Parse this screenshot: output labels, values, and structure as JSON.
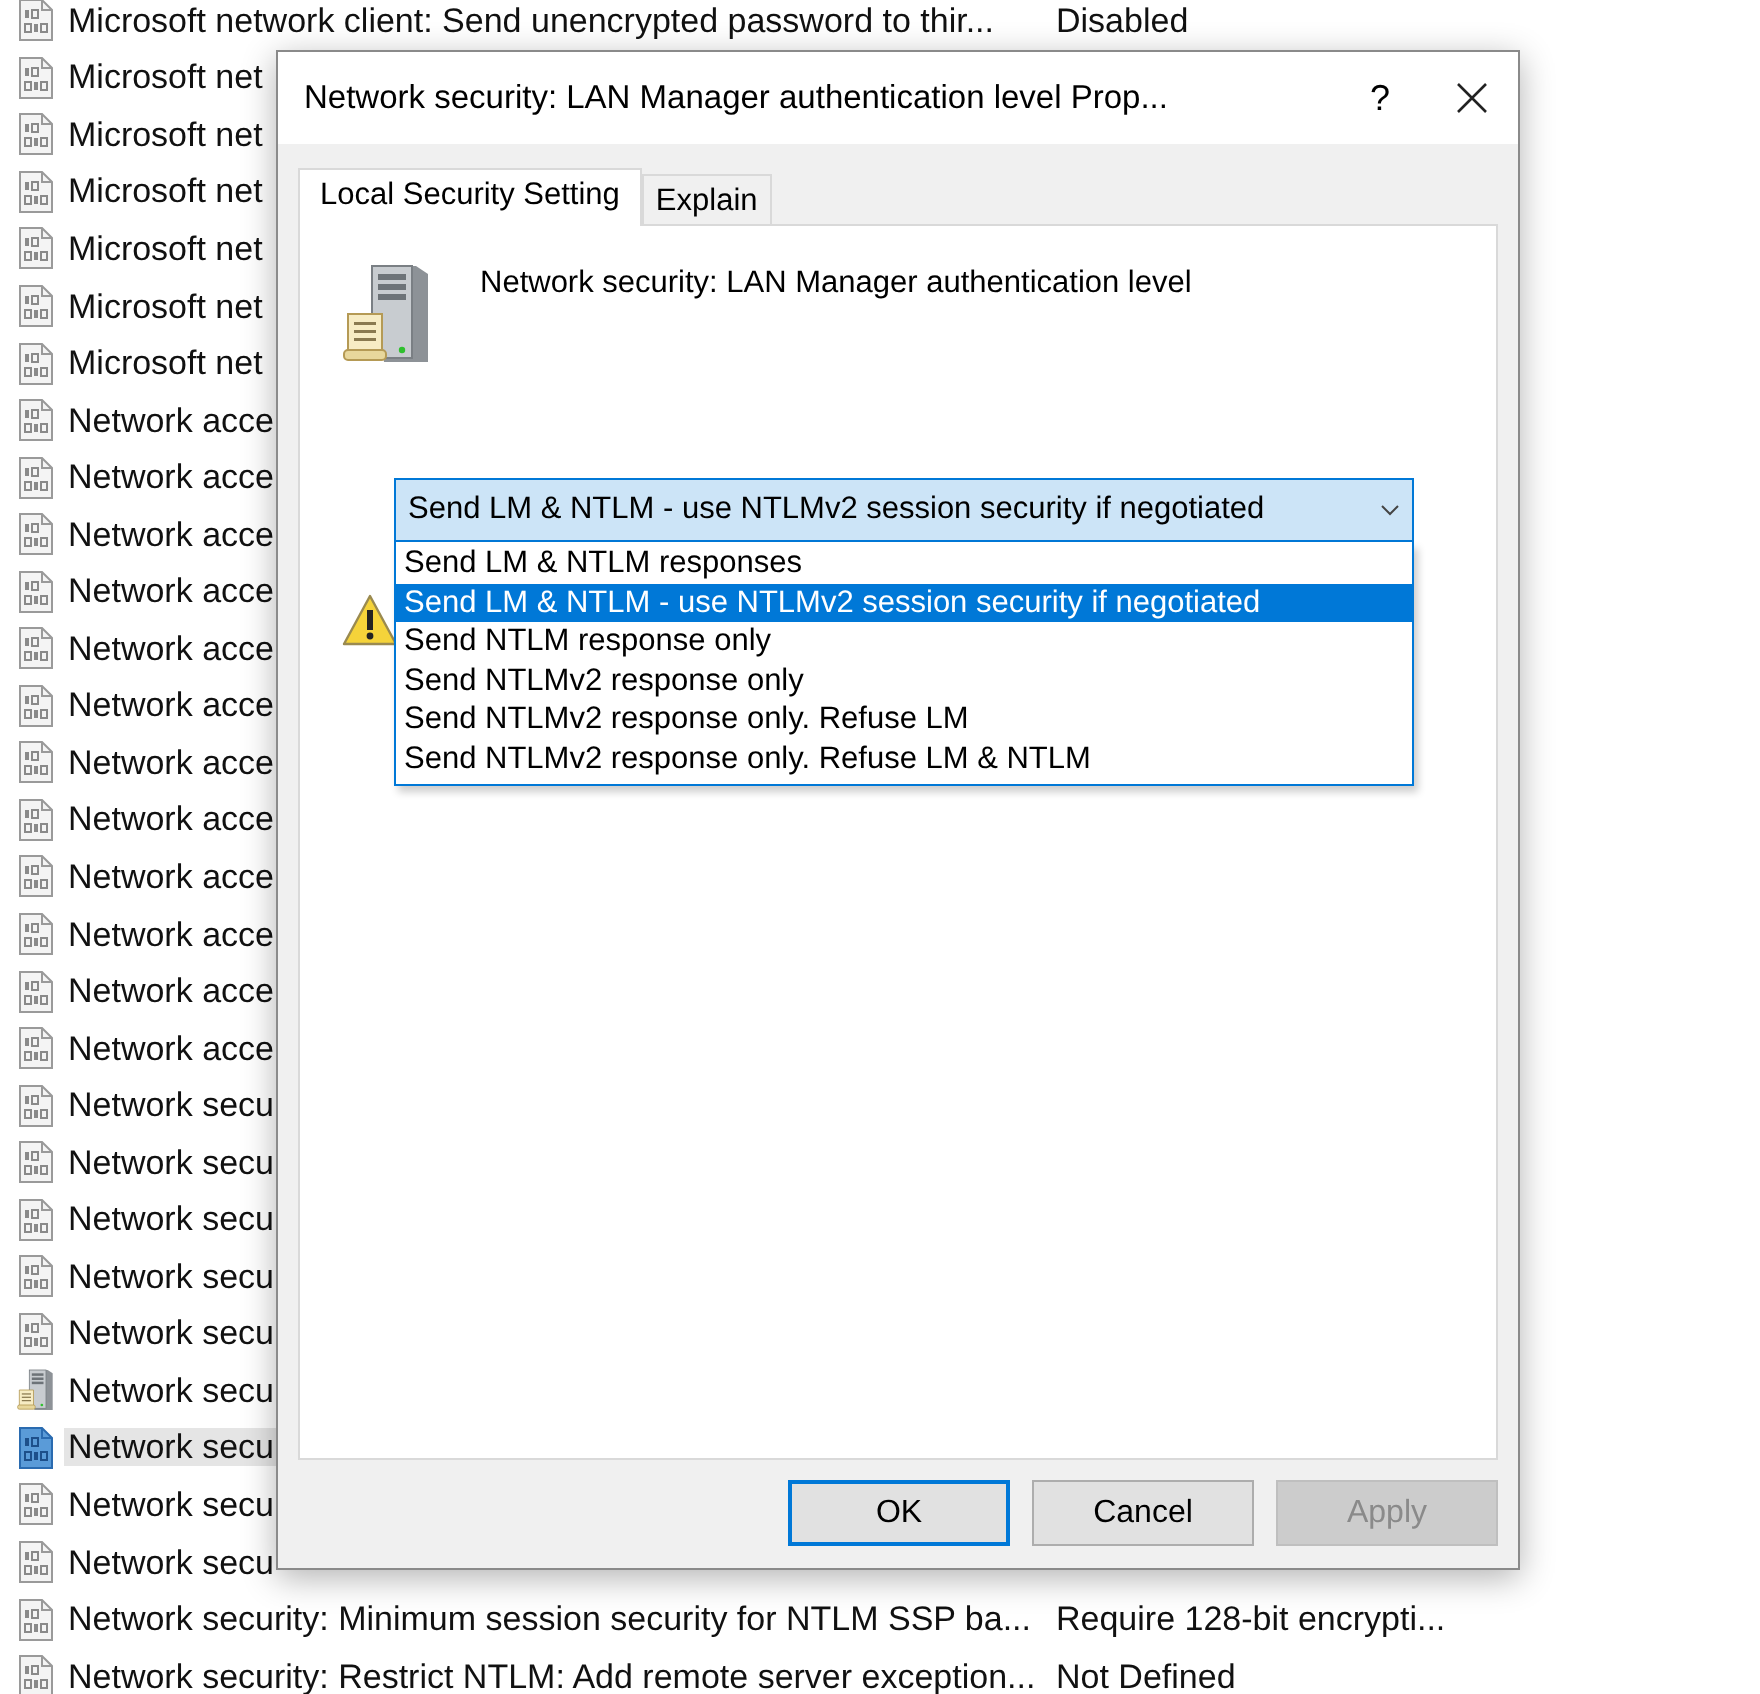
{
  "policy_list": {
    "rows": [
      {
        "name": "Microsoft network client: Send unencrypted password to thir...",
        "setting": "Disabled",
        "kind": "policy",
        "selected": false
      },
      {
        "name": "Microsoft net",
        "kind": "policy",
        "selected": false
      },
      {
        "name": "Microsoft net",
        "kind": "policy",
        "selected": false
      },
      {
        "name": "Microsoft net",
        "kind": "policy",
        "selected": false
      },
      {
        "name": "Microsoft net",
        "kind": "policy",
        "selected": false
      },
      {
        "name": "Microsoft net",
        "kind": "policy",
        "selected": false
      },
      {
        "name": "Microsoft net",
        "kind": "policy",
        "selected": false
      },
      {
        "name": "Network acce",
        "kind": "policy",
        "selected": false
      },
      {
        "name": "Network acce",
        "kind": "policy",
        "selected": false
      },
      {
        "name": "Network acce",
        "kind": "policy",
        "selected": false
      },
      {
        "name": "Network acce",
        "kind": "policy",
        "selected": false
      },
      {
        "name": "Network acce",
        "kind": "policy",
        "selected": false
      },
      {
        "name": "Network acce",
        "kind": "policy",
        "selected": false
      },
      {
        "name": "Network acce",
        "kind": "policy",
        "selected": false
      },
      {
        "name": "Network acce",
        "kind": "policy",
        "selected": false
      },
      {
        "name": "Network acce",
        "kind": "policy",
        "selected": false
      },
      {
        "name": "Network acce",
        "kind": "policy",
        "selected": false
      },
      {
        "name": "Network acce",
        "kind": "policy",
        "selected": false
      },
      {
        "name": "Network acce",
        "kind": "policy",
        "selected": false
      },
      {
        "name": "Network secu",
        "kind": "policy",
        "selected": false
      },
      {
        "name": "Network secu",
        "kind": "policy",
        "selected": false
      },
      {
        "name": "Network secu",
        "kind": "policy",
        "selected": false
      },
      {
        "name": "Network secu",
        "kind": "policy",
        "selected": false
      },
      {
        "name": "Network secu",
        "kind": "policy",
        "selected": false
      },
      {
        "name": "Network secu",
        "kind": "server",
        "selected": false
      },
      {
        "name": "Network secu",
        "kind": "policy",
        "selected": true
      },
      {
        "name": "Network secu",
        "kind": "policy",
        "selected": false
      },
      {
        "name": "Network secu",
        "kind": "policy",
        "selected": false
      },
      {
        "name": "Network security: Minimum session security for NTLM SSP ba...",
        "setting": "Require 128-bit encrypti...",
        "kind": "policy",
        "selected": false
      },
      {
        "name": "Network security: Restrict NTLM: Add remote server exception...",
        "setting": "Not Defined",
        "kind": "policy",
        "selected": false
      }
    ]
  },
  "dialog": {
    "title": "Network security: LAN Manager authentication level Prop...",
    "help": "?",
    "tabs": [
      {
        "label": "Local Security Setting",
        "selected": true
      },
      {
        "label": "Explain",
        "selected": false
      }
    ],
    "heading": "Network security: LAN Manager authentication level",
    "combobox": {
      "value": "Send LM & NTLM - use NTLMv2 session security if negotiated",
      "expanded": true
    },
    "options": [
      {
        "label": "Send LM & NTLM responses",
        "selected": false
      },
      {
        "label": "Send LM & NTLM - use NTLMv2 session security if negotiated",
        "selected": true
      },
      {
        "label": "Send NTLM response only",
        "selected": false
      },
      {
        "label": "Send NTLMv2 response only",
        "selected": false
      },
      {
        "label": "Send NTLMv2 response only. Refuse LM",
        "selected": false
      },
      {
        "label": "Send NTLMv2 response only. Refuse LM & NTLM",
        "selected": false
      }
    ],
    "buttons": [
      {
        "label": "OK",
        "kind": "default",
        "disabled": false
      },
      {
        "label": "Cancel",
        "kind": "normal",
        "disabled": false
      },
      {
        "label": "Apply",
        "kind": "normal",
        "disabled": true
      }
    ]
  }
}
